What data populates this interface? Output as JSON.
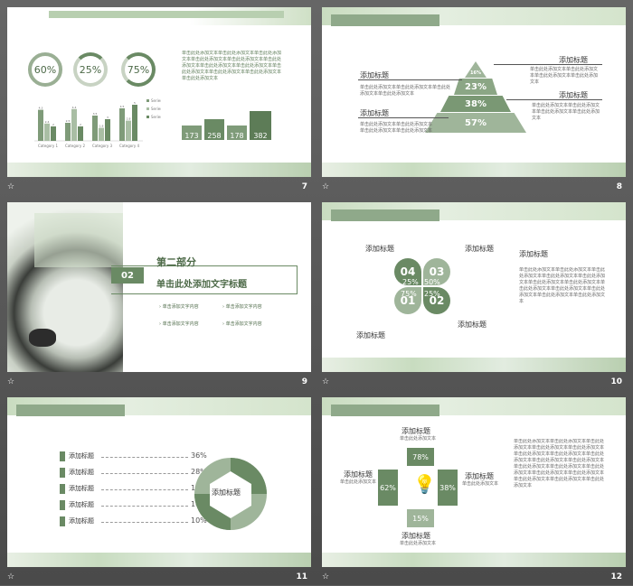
{
  "colors": {
    "accent": "#6a8a64",
    "light": "#9fb59a",
    "dark": "#4d6a48",
    "pale": "#c6d7bf"
  },
  "slides": [
    {
      "number": "7",
      "percents": [
        "60%",
        "25%",
        "75%"
      ],
      "text": "单击此处添加文本单击此处添加文本单击此处添加文本单击此处添加文本单击此处添加文本单击此处添加文本单击此处添加文本单击此处添加文本单击此处添加文本单击此处添加文本单击此处添加文本单击此处添加文本",
      "legend": [
        "Series 1",
        "Series 2",
        "Series 3"
      ],
      "categories": [
        "Category 1",
        "Category 2",
        "Category 3",
        "Category 4"
      ],
      "steps": [
        "173",
        "258",
        "178",
        "382"
      ]
    },
    {
      "number": "8",
      "title": "添加标题",
      "pyramid": [
        "16%",
        "23%",
        "38%",
        "57%"
      ],
      "text": "单击此处添加文本单击此处添加文本单击此处添加文本单击此处添加文本"
    },
    {
      "number": "9",
      "part_no": "02",
      "part_title": "第二部分",
      "subtitle": "单击此处添加文字标题",
      "items": [
        "单击添加文字内容",
        "单击添加文字内容",
        "单击添加文字内容",
        "单击添加文字内容"
      ]
    },
    {
      "number": "10",
      "title": "添加标题",
      "circles": [
        {
          "n": "04",
          "p": "25%"
        },
        {
          "n": "03",
          "p": "50%"
        },
        {
          "n": "01",
          "p": "75%"
        },
        {
          "n": "02",
          "p": "25%"
        }
      ],
      "text": "单击此处添加文本单击此处添加文本单击此处添加文本单击此处添加文本单击此处添加文本单击此处添加文本单击此处添加文本单击此处添加文本单击此处添加文本单击此处添加文本单击此处添加文本单击此处添加文本"
    },
    {
      "number": "11",
      "title": "添加标题",
      "rows": [
        "36%",
        "28%",
        "10%",
        "16%",
        "10%"
      ]
    },
    {
      "number": "12",
      "title": "添加标题",
      "sub": "单击此处添加文本",
      "values": {
        "top": "78%",
        "left": "62%",
        "right": "38%",
        "bottom": "15%"
      },
      "text": "单击此处添加文本单击此处添加文本单击此处添加文本单击此处添加文本单击此处添加文本单击此处添加文本单击此处添加文本单击此处添加文本单击此处添加文本单击此处添加文本单击此处添加文本单击此处添加文本单击此处添加文本单击此处添加文本单击此处添加文本单击此处添加文本单击此处添加文本单击此处添加文本"
    }
  ],
  "chart_data": {
    "type": "bar",
    "categories": [
      "Category 1",
      "Category 2",
      "Category 3",
      "Category 4"
    ],
    "series": [
      {
        "name": "Series 1",
        "values": [
          4.3,
          2.5,
          3.5,
          4.5
        ]
      },
      {
        "name": "Series 2",
        "values": [
          2.4,
          4.4,
          1.8,
          2.8
        ]
      },
      {
        "name": "Series 3",
        "values": [
          2,
          2,
          3,
          5
        ]
      }
    ],
    "ylim": [
      0,
      6
    ]
  }
}
